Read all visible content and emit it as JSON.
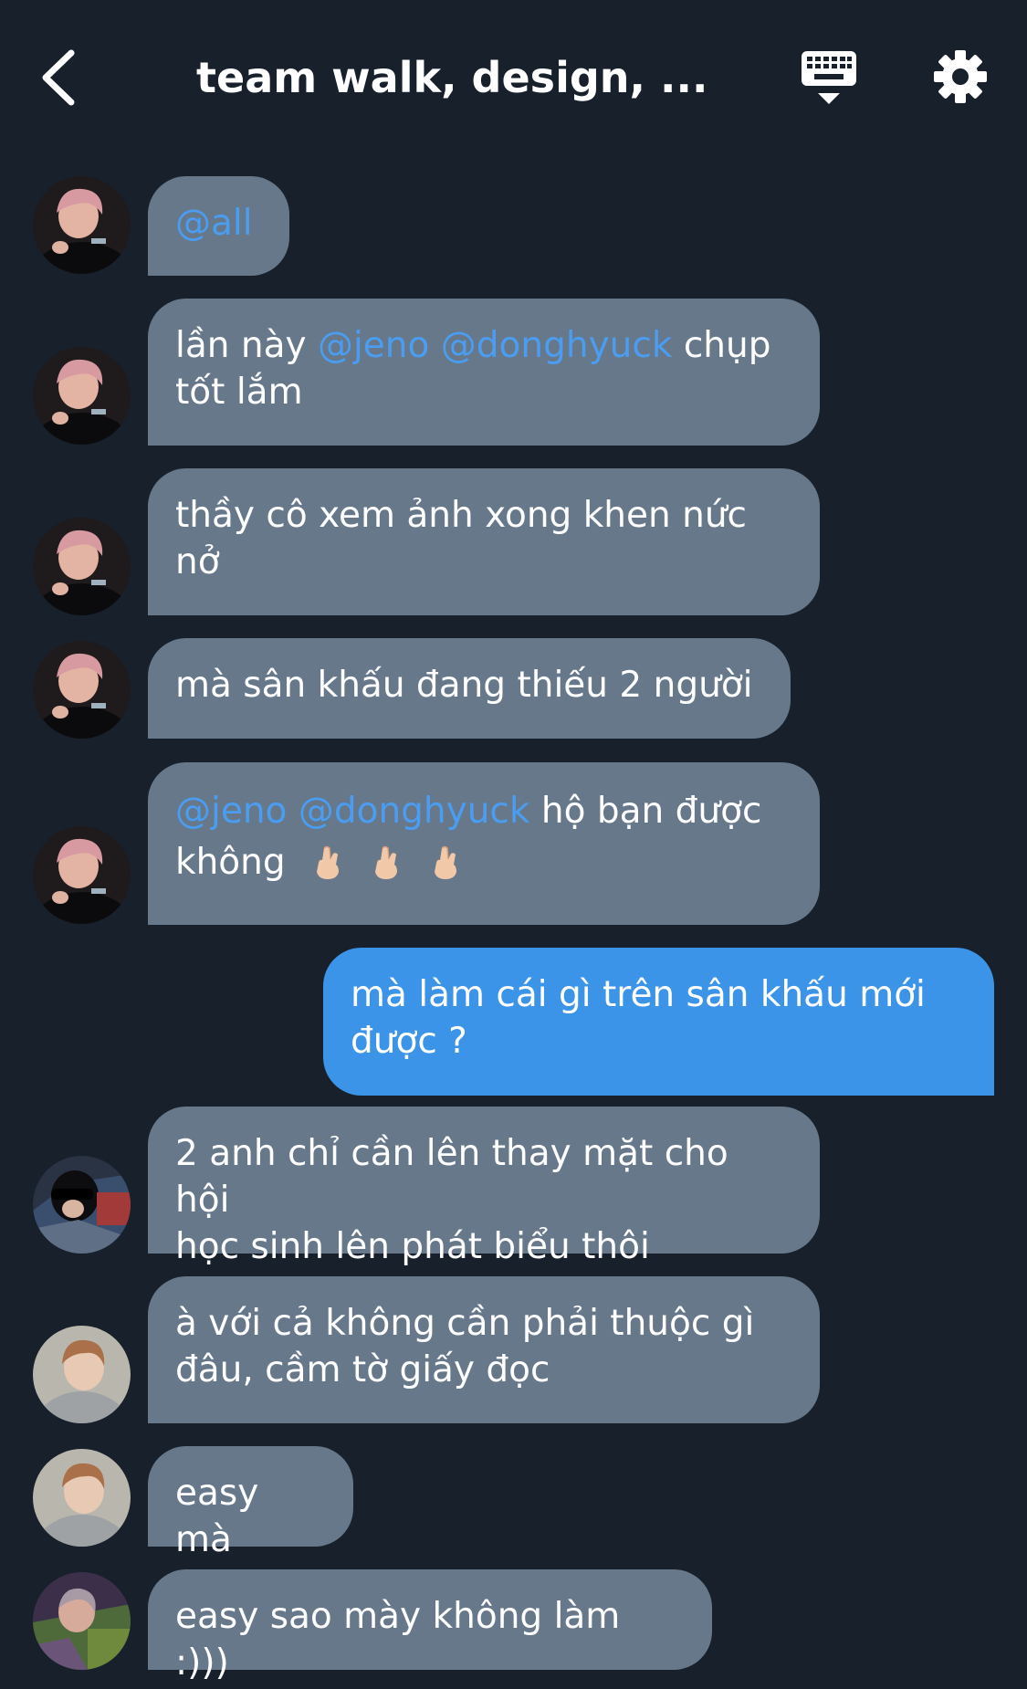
{
  "header": {
    "title": "team walk, design, ...",
    "back_icon": "chevron-left-icon",
    "keyboard_icon": "keyboard-icon",
    "settings_icon": "gear-icon"
  },
  "colors": {
    "background": "#17202b",
    "bubble_other": "#66788a",
    "bubble_me": "#3b94e8",
    "mention": "#4a9df0"
  },
  "messages": [
    {
      "sender": "other",
      "mention": "@all"
    },
    {
      "sender": "other",
      "prefix": "lần này",
      "mention1": "@jeno",
      "mention2": "@donghyuck",
      "text_after": "chụp",
      "line2": "tốt lắm"
    },
    {
      "sender": "other",
      "line1": "thầy cô xem ảnh xong khen nức",
      "line2": "nở"
    },
    {
      "sender": "other",
      "text": "mà sân khấu đang thiếu 2 người"
    },
    {
      "sender": "other",
      "mention1": "@jeno",
      "mention2": "@donghyuck",
      "text_after": "hộ bạn được",
      "line2": "không",
      "emoji": "crossed-fingers-emoji"
    },
    {
      "sender": "me",
      "line1": "mà làm cái gì trên sân khấu mới",
      "line2": "được ?"
    },
    {
      "sender": "other",
      "line1": "2 anh chỉ cần lên thay mặt cho hội",
      "line2": "học sinh lên phát biểu thôi"
    },
    {
      "sender": "other",
      "line1": "à với cả không cần phải thuộc gì",
      "line2": "đâu, cầm tờ giấy đọc"
    },
    {
      "sender": "other",
      "text": "easy mà"
    },
    {
      "sender": "other",
      "text": "easy sao mày không làm :)))"
    }
  ]
}
